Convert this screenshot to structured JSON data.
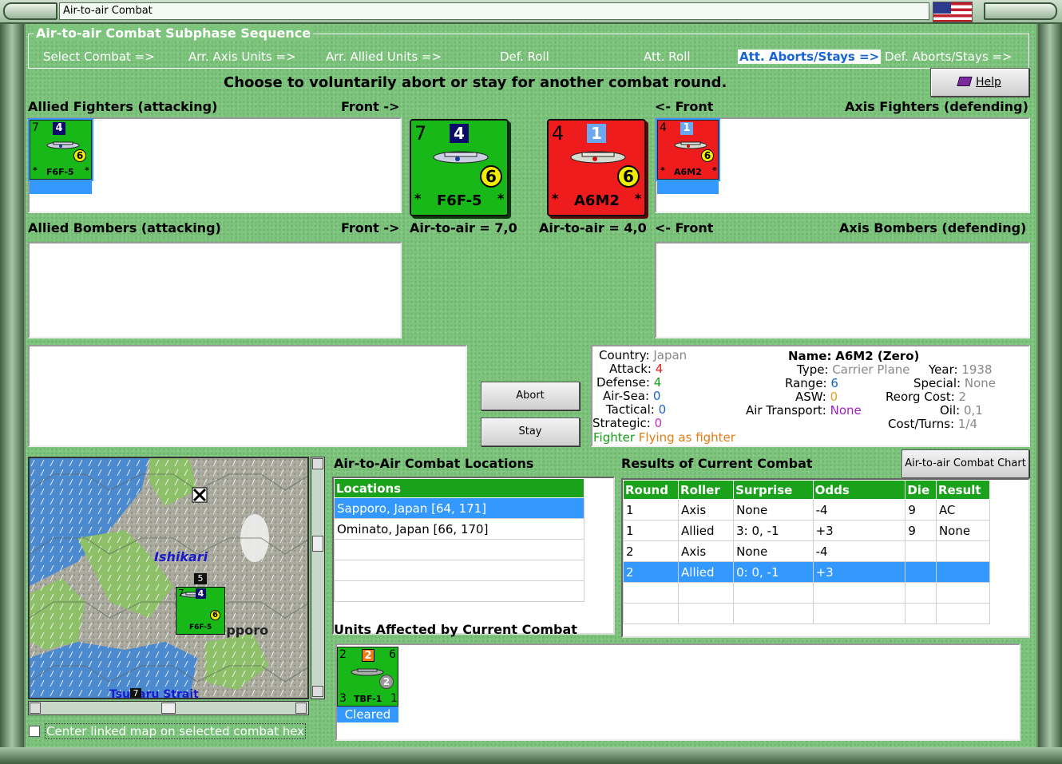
{
  "window": {
    "title": "Air-to-air Combat"
  },
  "sequence": {
    "title": "Air-to-air Combat Subphase Sequence",
    "steps": [
      "Select Combat =>",
      "Arr. Axis Units =>",
      "Arr. Allied Units =>",
      "Def. Roll",
      "Att. Roll",
      "Att. Aborts/Stays =>",
      "Def. Aborts/Stays =>"
    ],
    "active_index": 5
  },
  "instruction": "Choose to voluntarily abort or stay for another combat round.",
  "help_label": "Help",
  "labels": {
    "allied_fighters": "Allied Fighters (attacking)",
    "allied_bombers": "Allied Bombers (attacking)",
    "axis_fighters": "Axis Fighters (defending)",
    "axis_bombers": "Axis Bombers (defending)",
    "front_right": "Front ->",
    "front_left": "<- Front",
    "allied_air": "Air-to-air = 7,0",
    "axis_air": "Air-to-air = 4,0"
  },
  "units": {
    "allied": {
      "name": "F6F-5",
      "attack": "7",
      "defense": "4",
      "range": "6",
      "star": "*",
      "color": "#18b818"
    },
    "axis": {
      "name": "A6M2",
      "attack": "4",
      "defense": "1",
      "range": "6",
      "star": "*",
      "color": "#ee1c1c"
    },
    "tbf": {
      "name": "TBF-1",
      "tl": "2",
      "badge": "2",
      "tr": "6",
      "range": "2",
      "bl": "3",
      "br": "1",
      "status": "Cleared"
    }
  },
  "buttons": {
    "abort": "Abort",
    "stay": "Stay",
    "chart": "Air-to-air Combat Chart"
  },
  "unit_info": {
    "country_label": "Country:",
    "country": "Japan",
    "attack_label": "Attack:",
    "attack": "4",
    "defense_label": "Defense:",
    "defense": "4",
    "airsea_label": "Air-Sea:",
    "airsea": "0",
    "tactical_label": "Tactical:",
    "tactical": "0",
    "strategic_label": "Strategic:",
    "strategic": "0",
    "role_main": "Fighter",
    "role_sub": "Flying as fighter",
    "name_label": "Name:",
    "name": "A6M2 (Zero)",
    "type_label": "Type:",
    "type": "Carrier Plane",
    "range_label": "Range:",
    "range": "6",
    "asw_label": "ASW:",
    "asw": "0",
    "transport_label": "Air Transport:",
    "transport": "None",
    "year_label": "Year:",
    "year": "1938",
    "special_label": "Special:",
    "special": "None",
    "reorg_label": "Reorg Cost:",
    "reorg": "2",
    "oil_label": "Oil:",
    "oil": "0,1",
    "costturns_label": "Cost/Turns:",
    "costturns": "1/4"
  },
  "locations": {
    "title": "Air-to-Air Combat Locations",
    "header": "Locations",
    "rows": [
      "Sapporo, Japan [64, 171]",
      "Ominato, Japan [66, 170]",
      "",
      "",
      ""
    ],
    "selected": 0
  },
  "results": {
    "title": "Results of Current Combat",
    "headers": [
      "Round",
      "Roller",
      "Surprise",
      "Odds",
      "Die",
      "Result"
    ],
    "rows": [
      [
        "1",
        "Axis",
        "None",
        "-4",
        "9",
        "AC"
      ],
      [
        "1",
        "Allied",
        "3: 0, -1",
        "+3",
        "9",
        "None"
      ],
      [
        "2",
        "Axis",
        "None",
        "-4",
        "",
        ""
      ],
      [
        "2",
        "Allied",
        "0: 0, -1",
        "+3",
        "",
        ""
      ],
      [
        "",
        "",
        "",
        "",
        "",
        ""
      ],
      [
        "",
        "",
        "",
        "",
        "",
        ""
      ]
    ],
    "selected": 3
  },
  "affected_title": "Units Affected by Current Combat",
  "map": {
    "labels": {
      "ishikari": "Ishikari",
      "strait": "Tsugaru Strait",
      "city": "Sapporo"
    },
    "counter_top": "5",
    "counter_bottom": "7"
  },
  "checkbox_label": "Center linked map on selected combat hex"
}
